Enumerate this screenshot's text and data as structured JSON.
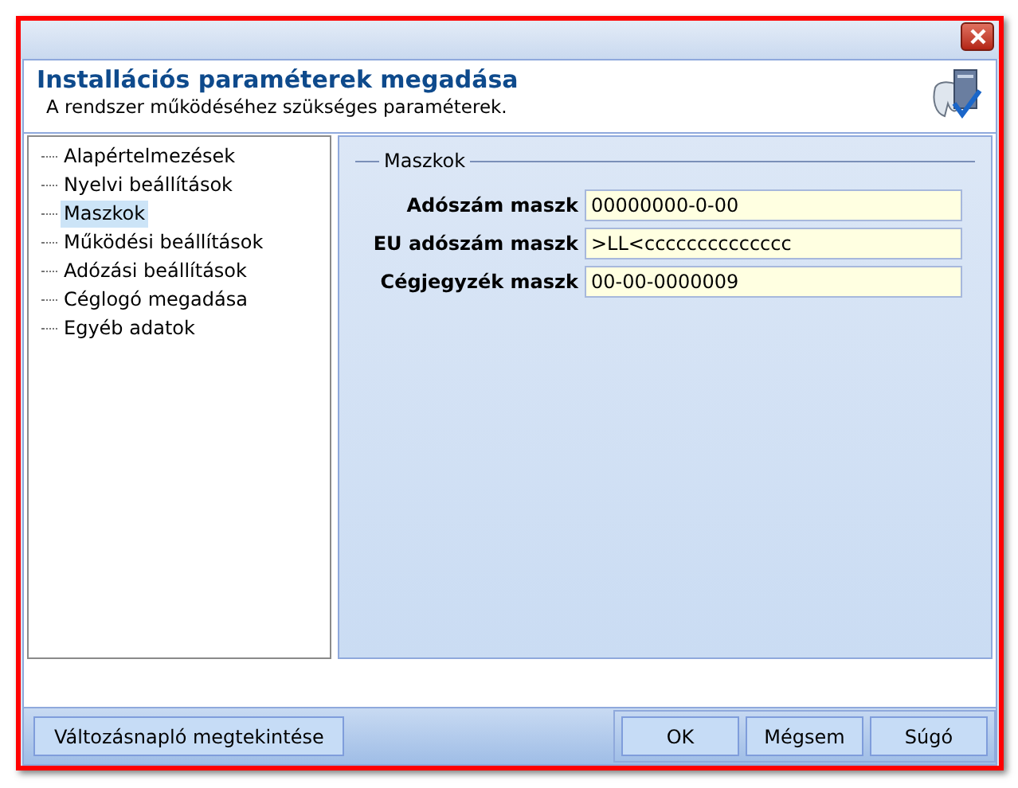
{
  "header": {
    "title": "Installációs paraméterek megadása",
    "subtitle": "A rendszer működéséhez szükséges paraméterek."
  },
  "tree": [
    {
      "label": "Alapértelmezések",
      "selected": false
    },
    {
      "label": "Nyelvi beállítások",
      "selected": false
    },
    {
      "label": "Maszkok",
      "selected": true
    },
    {
      "label": "Működési beállítások",
      "selected": false
    },
    {
      "label": "Adózási beállítások",
      "selected": false
    },
    {
      "label": "Céglogó megadása",
      "selected": false
    },
    {
      "label": "Egyéb adatok",
      "selected": false
    }
  ],
  "group": {
    "title": "Maszkok",
    "fields": [
      {
        "label": "Adószám maszk",
        "value": "00000000-0-00"
      },
      {
        "label": "EU adószám maszk",
        "value": ">LL<cccccccccccccc"
      },
      {
        "label": "Cégjegyzék maszk",
        "value": "00-00-0000009"
      }
    ]
  },
  "buttons": {
    "left": "Változásnapló megtekintése",
    "right": [
      "OK",
      "Mégsem",
      "Súgó"
    ]
  }
}
